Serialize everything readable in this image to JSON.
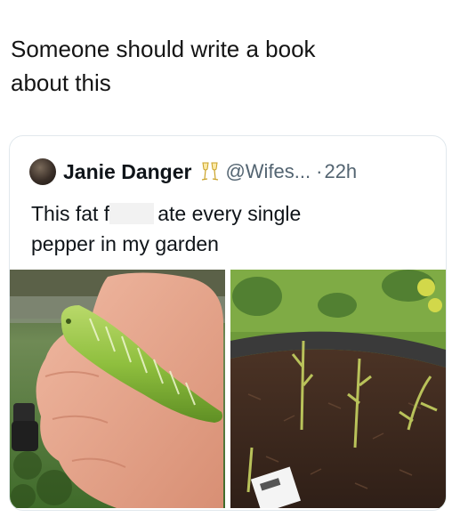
{
  "post": {
    "caption_line1": "Someone should write a book",
    "caption_line2": "about this"
  },
  "quoted_tweet": {
    "display_name": "Janie Danger",
    "emoji_icon": "clinking-glasses-icon",
    "handle": "@Wifes...",
    "separator": "·",
    "time": "22h",
    "text_part1": "This fat f",
    "text_part2": "ate every single",
    "text_line2": "pepper in my garden"
  },
  "colors": {
    "text": "#0f1419",
    "muted": "#536471",
    "border": "#e1e8ed"
  }
}
